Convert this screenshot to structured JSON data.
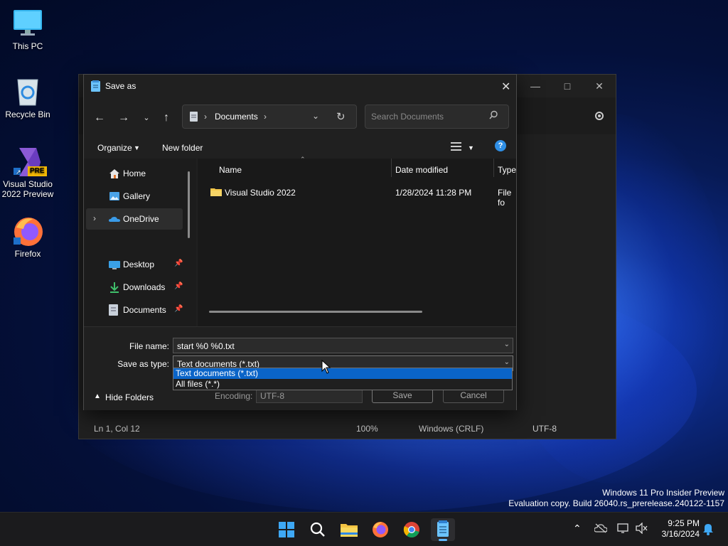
{
  "desktop": {
    "icons": [
      {
        "label": "This PC"
      },
      {
        "label": "Recycle Bin"
      },
      {
        "label": "Visual Studio 2022 Preview",
        "badge": "PRE"
      },
      {
        "label": "Firefox"
      }
    ],
    "watermark": {
      "line1": "Windows 11 Pro Insider Preview",
      "line2": "Evaluation copy. Build 26040.rs_prerelease.240122-1157"
    }
  },
  "notepad": {
    "status": {
      "position": "Ln 1, Col 12",
      "zoom": "100%",
      "line_ending": "Windows (CRLF)",
      "encoding": "UTF-8"
    }
  },
  "dialog": {
    "title": "Save as",
    "breadcrumb": "Documents",
    "search_placeholder": "Search Documents",
    "commands": {
      "organize": "Organize",
      "new_folder": "New folder"
    },
    "nav": {
      "home": "Home",
      "gallery": "Gallery",
      "onedrive": "OneDrive",
      "desktop": "Desktop",
      "downloads": "Downloads",
      "documents": "Documents"
    },
    "columns": {
      "name": "Name",
      "date": "Date modified",
      "type": "Type"
    },
    "files": [
      {
        "name": "Visual Studio 2022",
        "date": "1/28/2024 11:28 PM",
        "type": "File fo"
      }
    ],
    "file_name_label": "File name:",
    "file_name_value": "start %0 %0.txt",
    "save_type_label": "Save as type:",
    "save_type_value": "Text documents (*.txt)",
    "save_type_options": [
      "Text documents (*.txt)",
      "All files  (*.*)"
    ],
    "hide_folders": "Hide Folders",
    "encoding_label": "Encoding:",
    "encoding_value": "UTF-8",
    "save_button": "Save",
    "cancel_button": "Cancel"
  },
  "taskbar": {
    "time": "9:25 PM",
    "date": "3/16/2024"
  },
  "colors": {
    "accent": "#0078d4",
    "selection": "#0a64c8",
    "dialog_bg": "#202020"
  }
}
